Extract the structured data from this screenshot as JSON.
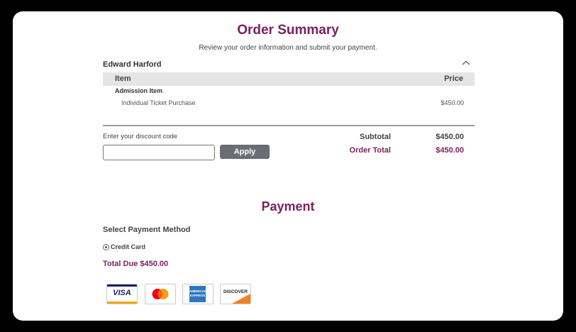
{
  "order_summary": {
    "title": "Order Summary",
    "subtitle": "Review your order information and submit your payment.",
    "customer_name": "Edward Harford",
    "table": {
      "headers": [
        "Item",
        "Price"
      ],
      "category": "Admission Item",
      "rows": [
        {
          "label": "Individual Ticket Purchase",
          "price": "$450.00"
        }
      ]
    },
    "discount": {
      "label": "Enter your discount code",
      "value": "",
      "placeholder": "",
      "apply_label": "Apply"
    },
    "totals": {
      "subtotal_label": "Subtotal",
      "subtotal_value": "$450.00",
      "order_total_label": "Order Total",
      "order_total_value": "$450.00"
    }
  },
  "payment": {
    "title": "Payment",
    "select_label": "Select Payment Method",
    "method_label": "Credit Card",
    "method_selected": true,
    "total_due": "Total Due $450.00",
    "cards": [
      {
        "icon": "visa-icon",
        "text": "VISA"
      },
      {
        "icon": "mastercard-icon",
        "text": ""
      },
      {
        "icon": "amex-icon",
        "text": "AMERICAN EXPRESS"
      },
      {
        "icon": "discover-icon",
        "text": "DISCOVER"
      }
    ]
  },
  "colors": {
    "accent": "#7a1f5c",
    "button": "#6c6c74",
    "table_header": "#e5e5e5"
  }
}
